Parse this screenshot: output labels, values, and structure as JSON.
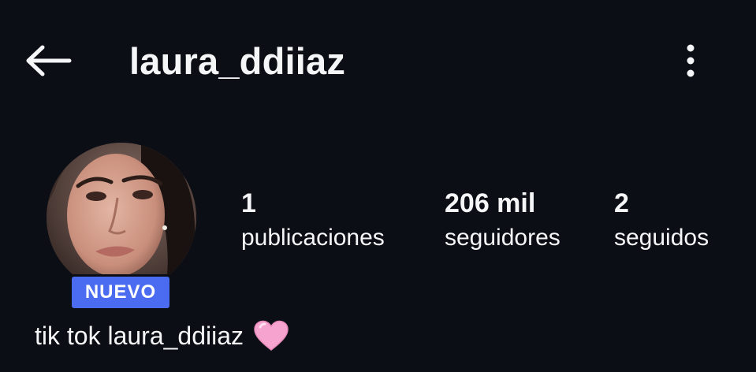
{
  "header": {
    "username": "laura_ddiiaz"
  },
  "icons": {
    "back": "arrow-left-icon",
    "more": "more-vertical-icon",
    "heart": "pink-heart-icon"
  },
  "profile": {
    "badge": "NUEVO",
    "stats": {
      "posts_value": "1",
      "posts_label": "publicaciones",
      "followers_value": "206 mil",
      "followers_label": "seguidores",
      "following_value": "2",
      "following_label": "seguidos"
    },
    "bio": "tik tok laura_ddiiaz"
  },
  "colors": {
    "background": "#0b0e14",
    "text": "#f5f6f8",
    "badge": "#4b6cf0",
    "heart": "#f7a3cf"
  }
}
